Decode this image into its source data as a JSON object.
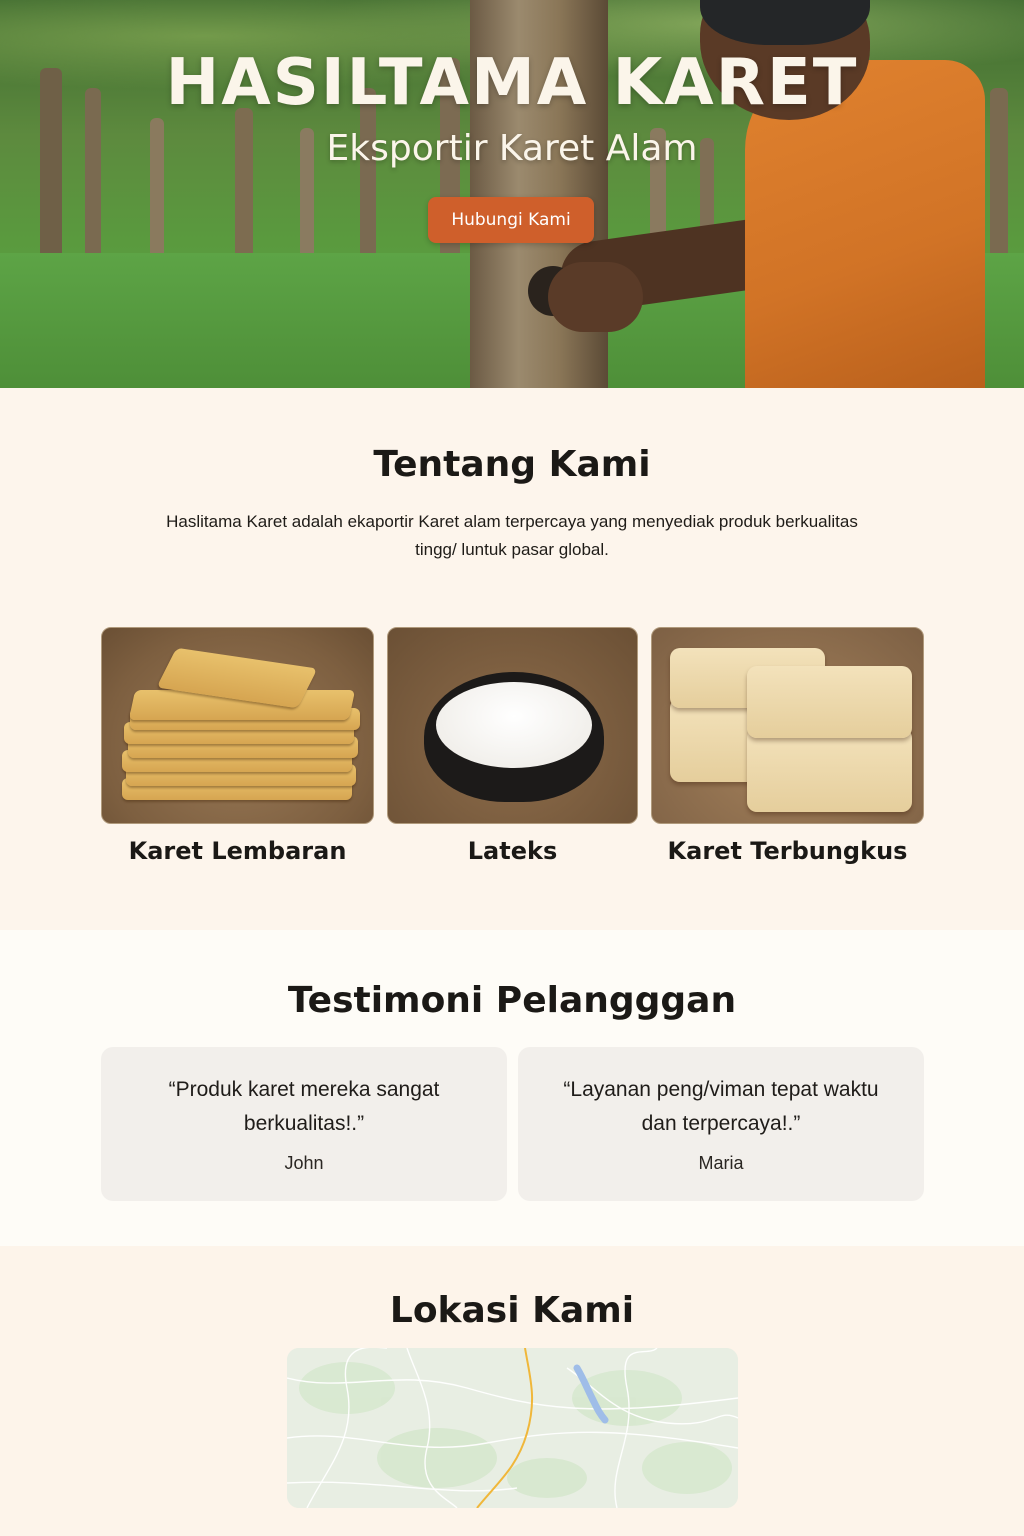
{
  "hero": {
    "title": "HASILTAMA KARET",
    "subtitle": "Eksportir Karet Alam",
    "cta_label": "Hubungi Kami"
  },
  "about": {
    "title": "Tentang Kami",
    "text": "Haslitama Karet adalah ekaportir Karet alam terpercaya yang menyediak produk berkualitas tingg/ luntuk pasar global."
  },
  "products": [
    {
      "label": "Karet Lembaran"
    },
    {
      "label": "Lateks"
    },
    {
      "label": "Karet Terbungkus"
    }
  ],
  "testimonials": {
    "title": "Testimoni Pelangggan",
    "items": [
      {
        "quote": "“Produk karet mereka sangat berkualitas!.”",
        "author": "John"
      },
      {
        "quote": "“Layanan peng/viman tepat waktu dan terpercaya!.”",
        "author": "Maria"
      }
    ]
  },
  "location": {
    "title": "Lokasi Kami"
  },
  "colors": {
    "accent": "#cf5f2b",
    "section_bg": "#fdf5ec",
    "card_bg": "#f2efeb"
  }
}
